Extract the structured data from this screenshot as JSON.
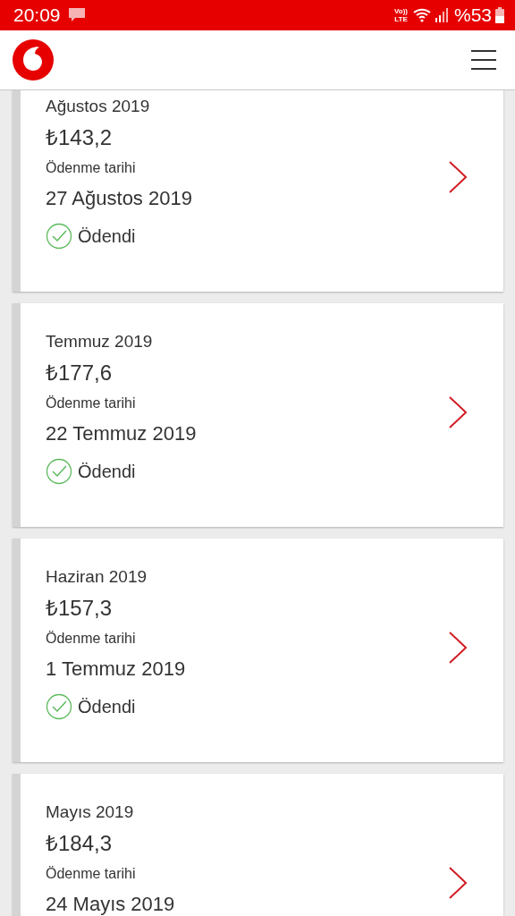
{
  "status_bar": {
    "time": "20:09",
    "network": "Vo)) LTE",
    "battery": "%53"
  },
  "bills": [
    {
      "period": "Ağustos 2019",
      "amount": "₺143,2",
      "due_label": "Ödenme tarihi",
      "due_date": "27 Ağustos 2019",
      "status": {
        "text": "Ödendi",
        "paid": true
      }
    },
    {
      "period": "Temmuz 2019",
      "amount": "₺177,6",
      "due_label": "Ödenme tarihi",
      "due_date": "22 Temmuz 2019",
      "status": {
        "text": "Ödendi",
        "paid": true
      }
    },
    {
      "period": "Haziran 2019",
      "amount": "₺157,3",
      "due_label": "Ödenme tarihi",
      "due_date": "1 Temmuz 2019",
      "status": {
        "text": "Ödendi",
        "paid": true
      }
    },
    {
      "period": "Mayıs 2019",
      "amount": "₺184,3",
      "due_label": "Ödenme tarihi",
      "due_date": "24 Mayıs 2019"
    }
  ]
}
